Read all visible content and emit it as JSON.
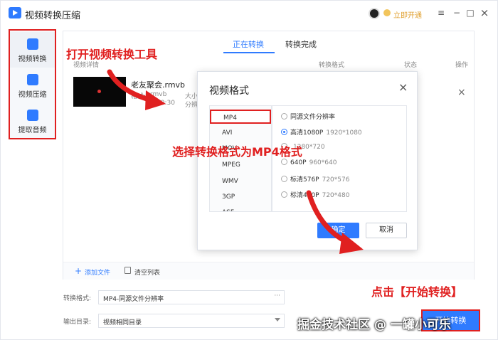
{
  "app": {
    "title": "视频转换压缩",
    "vip_label": "立即开通"
  },
  "window_controls": {
    "menu": "≡",
    "minimize": "−",
    "maximize": "□",
    "close": "×"
  },
  "sidebar": {
    "items": [
      {
        "label": "视频转换"
      },
      {
        "label": "视频压缩"
      },
      {
        "label": "提取音频"
      }
    ]
  },
  "tabs": [
    {
      "label": "正在转换"
    },
    {
      "label": "转换完成"
    }
  ],
  "list_headers": {
    "details": "视频详情",
    "format": "转换格式",
    "status": "状态",
    "action": "操作"
  },
  "file": {
    "name": "老友聚会.rmvb",
    "format_label": "格式:",
    "format_value": "rmvb",
    "size_label": "大小",
    "duration_fragment": "00:30",
    "resolution_label": "分辨",
    "remove": "×"
  },
  "footer": {
    "add_plus": "+",
    "add_file": "添加文件",
    "clear_list": "清空列表"
  },
  "output_format": {
    "label": "转换格式:",
    "value": "MP4-同源文件分辨率",
    "more": "···"
  },
  "output_dir": {
    "label": "输出目录:",
    "value": "视频相同目录"
  },
  "start_button": {
    "label": "开始转换"
  },
  "modal": {
    "title": "视频格式",
    "close": "×",
    "formats": [
      "MP4",
      "AVI",
      "MOV",
      "MPEG",
      "WMV",
      "3GP",
      "ASF"
    ],
    "resolutions": [
      {
        "label": "同源文件分辨率",
        "dims": "",
        "selected": false
      },
      {
        "label": "高清1080P",
        "dims": "1920*1080",
        "selected": true
      },
      {
        "label": "",
        "dims": "1280*720",
        "selected": false
      },
      {
        "label": "640P",
        "dims": "960*640",
        "selected": false
      },
      {
        "label": "标清576P",
        "dims": "720*576",
        "selected": false
      },
      {
        "label": "标清480P",
        "dims": "720*480",
        "selected": false
      }
    ],
    "ok": "确定",
    "cancel": "取消"
  },
  "annotations": {
    "step1": "打开视频转换工具",
    "step2": "选择转换格式为MP4格式",
    "step3": "点击【开始转换】"
  },
  "watermark": "掘金技术社区 @ 一罐小可乐",
  "colors": {
    "accent": "#2f7bff",
    "annotation": "#e02020"
  }
}
